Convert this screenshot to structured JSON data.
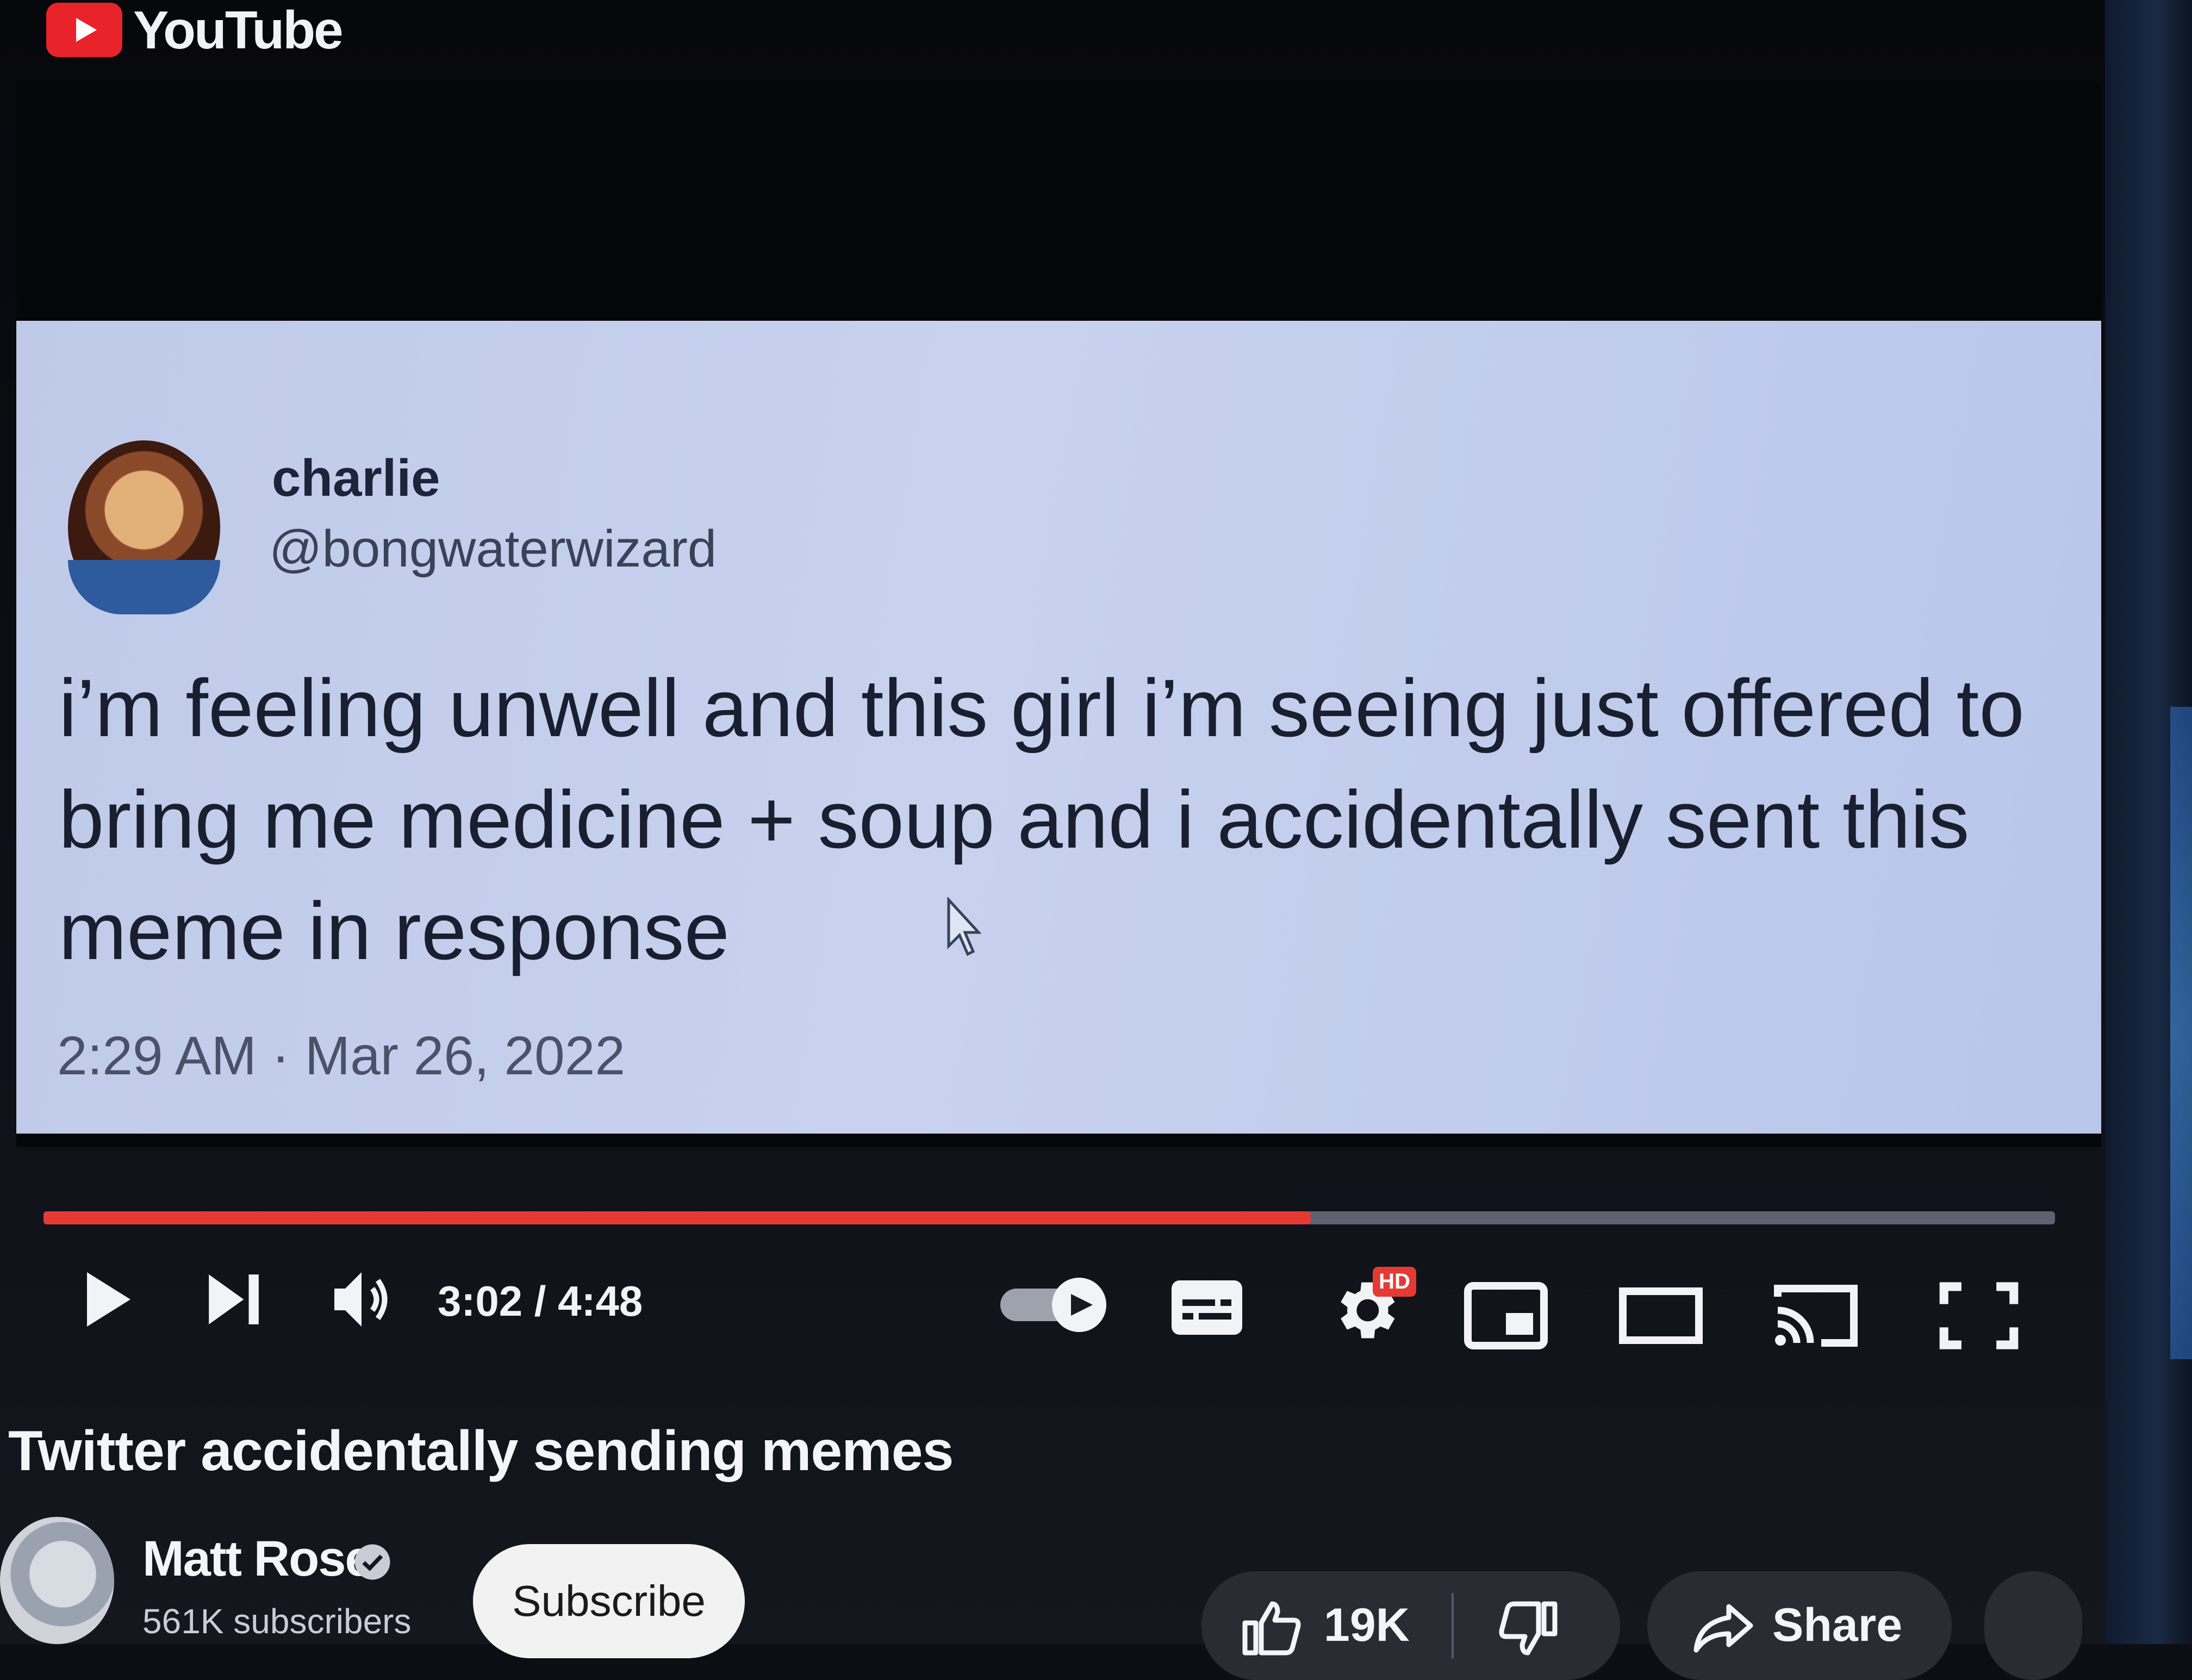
{
  "header": {
    "logo_text": "YouTube"
  },
  "tweet": {
    "name": "charlie",
    "handle": "@bongwaterwizard",
    "text": "i’m feeling unwell and this girl i’m seeing just offered to bring me medicine + soup and i accidentally sent this meme in response",
    "timestamp": "2:29 AM · Mar 26, 2022"
  },
  "player": {
    "progress_fraction": 0.63,
    "time_display": "3:02 / 4:48",
    "hd_badge": "HD",
    "icons": [
      "play-icon",
      "next-icon",
      "volume-icon",
      "autoplay-toggle",
      "subtitles-icon",
      "settings-gear-icon",
      "miniplayer-icon",
      "theater-mode-icon",
      "cast-icon",
      "fullscreen-icon"
    ]
  },
  "video": {
    "title": "Twitter accidentally sending memes",
    "channel_name": "Matt Rose",
    "subscribers": "561K subscribers",
    "subscribe_label": "Subscribe",
    "like_count": "19K",
    "share_label": "Share"
  },
  "colors": {
    "accent": "#e53a34",
    "tweet_bg": "#c3cdec",
    "background": "#0d0e13"
  }
}
